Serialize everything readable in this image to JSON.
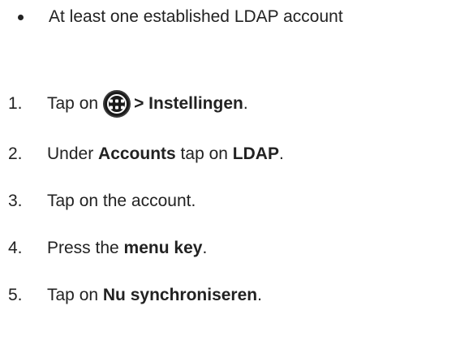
{
  "requirements": {
    "bullet_text": "At least one established LDAP account"
  },
  "steps": [
    {
      "number": "1.",
      "prefix": "Tap on",
      "icon": "apps-grid-icon",
      "bold": "> Instellingen",
      "suffix": "."
    },
    {
      "number": "2.",
      "prefix": "Under ",
      "bold1": "Accounts",
      "middle": " tap on ",
      "bold2": "LDAP",
      "suffix": "."
    },
    {
      "number": "3.",
      "text": "Tap on the account."
    },
    {
      "number": "4.",
      "prefix": "Press the ",
      "bold": "menu key",
      "suffix": "."
    },
    {
      "number": "5.",
      "prefix": "Tap on ",
      "bold": "Nu synchroniseren",
      "suffix": "."
    }
  ]
}
